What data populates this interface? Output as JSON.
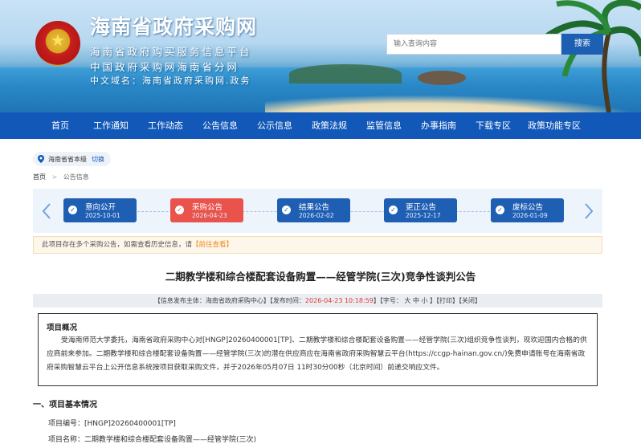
{
  "header": {
    "site_title": "海南省政府采购网",
    "subtitle_1": "海南省政府购买服务信息平台",
    "subtitle_2": "中国政府采购网海南省分网",
    "domain_label": "中文域名：海南省政府采购网.政务",
    "search_placeholder": "输入查询内容",
    "search_button": "搜索"
  },
  "nav": {
    "items": [
      "首页",
      "工作通知",
      "工作动态",
      "公告信息",
      "公示信息",
      "政策法规",
      "监管信息",
      "办事指南",
      "下载专区",
      "政策功能专区"
    ]
  },
  "location": {
    "region": "海南省省本级",
    "switch_label": "切换"
  },
  "breadcrumb": {
    "home": "首页",
    "separator": ">",
    "current": "公告信息"
  },
  "timeline": {
    "nodes": [
      {
        "label": "意向公开",
        "date": "2025-10-01",
        "active": false
      },
      {
        "label": "采购公告",
        "date": "2026-04-23",
        "active": true
      },
      {
        "label": "结果公告",
        "date": "2026-02-02",
        "active": false
      },
      {
        "label": "更正公告",
        "date": "2025-12-17",
        "active": false
      },
      {
        "label": "废标公告",
        "date": "2026-01-09",
        "active": false
      }
    ]
  },
  "notice": {
    "text": "此项目存在多个采购公告，如需查看历史信息，请",
    "link": "【前往查看】"
  },
  "article": {
    "title": "二期教学楼和综合楼配套设备购置——经管学院(三次)竞争性谈判公告",
    "meta_prefix": "【信息发布主体：海南省政府采购中心】【发布时间：",
    "meta_time": "2026-04-23 10:18:59",
    "meta_suffix": "】【字号： 大 中 小 】【打印】【关闭】",
    "overview_heading": "项目概况",
    "overview_text": "受海南师范大学委托，海南省政府采购中心对[HNGP]20260400001[TP]、二期教学楼和综合楼配套设备购置——经管学院(三次)组织竞争性谈判，现欢迎国内合格的供应商前来参加。二期教学楼和综合楼配套设备购置——经管学院(三次)的潜在供应商应在海南省政府采购智慧云平台(https://ccgp-hainan.gov.cn/)免费申请账号在海南省政府采购智慧云平台上公开信息系统按项目获取采购文件，并于2026年05月07日 11时30分00秒（北京时间）前递交响应文件。",
    "section_1": "一、项目基本情况",
    "project_no": "项目编号：[HNGP]20260400001[TP]",
    "project_name": "项目名称：二期教学楼和综合楼配套设备购置——经管学院(三次)"
  },
  "colors": {
    "nav_bg": "#1158b8",
    "active_node": "#e9534c",
    "node": "#1e5fb4",
    "link_orange": "#ef8a1e"
  }
}
